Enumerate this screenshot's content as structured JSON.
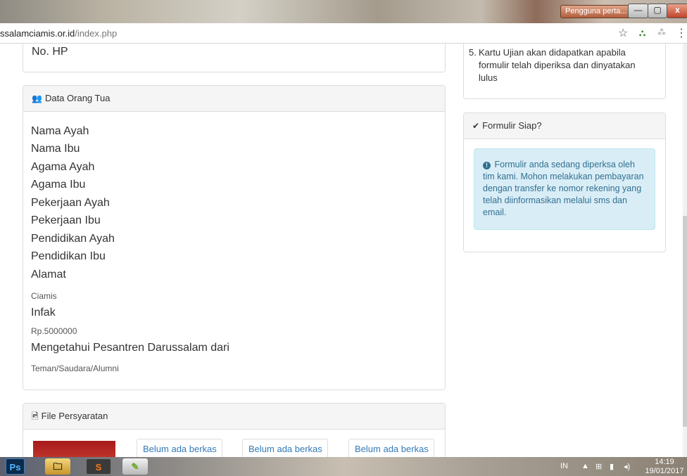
{
  "window": {
    "user_chip": "Pengguna perta...",
    "minimize_label": "—",
    "maximize_label": "▢",
    "close_label": "x"
  },
  "browser": {
    "url_host": "ssalamciamis.or.id",
    "url_path": "/index.php",
    "star_icon": "star-icon",
    "menu_icon": "menu-icon"
  },
  "top_panel": {
    "label": "No. HP"
  },
  "orang_tua": {
    "heading": "Data Orang Tua",
    "icon": "users-icon",
    "fields": {
      "nama_ayah": "Nama Ayah",
      "nama_ibu": "Nama Ibu",
      "agama_ayah": "Agama Ayah",
      "agama_ibu": "Agama Ibu",
      "pekerjaan_ayah": "Pekerjaan Ayah",
      "pekerjaan_ibu": "Pekerjaan Ibu",
      "pendidikan_ayah": "Pendidikan Ayah",
      "pendidikan_ibu": "Pendidikan Ibu",
      "alamat_label": "Alamat",
      "alamat_value": "Ciamis",
      "infak_label": "Infak",
      "infak_value": "Rp.5000000",
      "mengetahui_label": "Mengetahui Pesantren Darussalam dari",
      "mengetahui_value": "Teman/Saudara/Alumni"
    }
  },
  "file_persyaratan": {
    "heading": "File Persyaratan",
    "icon": "image-file-icon",
    "files": [
      "Belum ada berkas",
      "Belum ada berkas",
      "Belum ada berkas"
    ]
  },
  "sidebar": {
    "list_item_number": "5.",
    "list_item_text": "Kartu Ujian akan didapatkan apabila formulir telah diperiksa dan dinyatakan lulus",
    "formulir_heading": "Formulir Siap?",
    "formulir_icon": "check-icon",
    "alert_text": "Formulir anda sedang diperksa oleh tim kami. Mohon melakukan pembayaran dengan transfer ke nomor rekening yang telah diinformasikan melalui sms dan email.",
    "alert_icon": "info-circle-icon"
  },
  "taskbar": {
    "ps_label": "Ps",
    "s_label": "S",
    "lang": "IN",
    "clock_time": "14:19",
    "clock_date": "19/01/2017"
  }
}
